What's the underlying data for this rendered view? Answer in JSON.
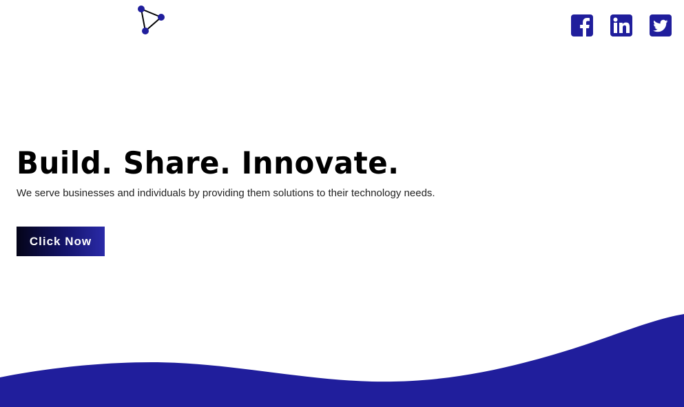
{
  "header": {
    "logo_icon": "triangle-nodes-icon",
    "social": [
      {
        "name": "facebook-icon"
      },
      {
        "name": "linkedin-icon"
      },
      {
        "name": "twitter-icon"
      }
    ]
  },
  "hero": {
    "title": "Build. Share. Innovate.",
    "subtitle": "We serve businesses and individuals by providing them solutions to their technology needs.",
    "cta_label": "Click Now"
  },
  "colors": {
    "brand": "#201e9c",
    "cta_gradient_start": "#040418",
    "cta_gradient_end": "#2a2aa8",
    "text": "#000000"
  }
}
